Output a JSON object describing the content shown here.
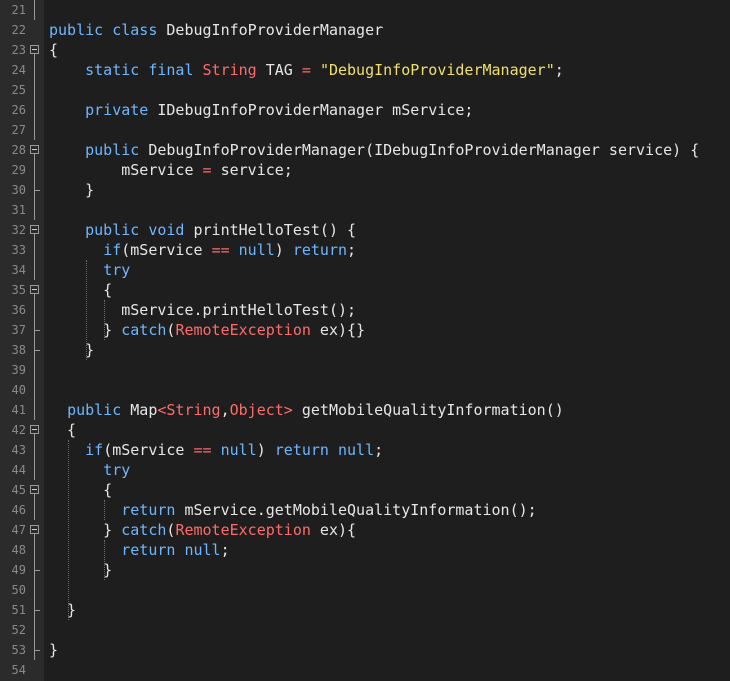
{
  "editor": {
    "lines": [
      {
        "n": "21",
        "fold": "line",
        "t": []
      },
      {
        "n": "22",
        "fold": "none",
        "t": [
          [
            "kw",
            "public"
          ],
          [
            "pl",
            " "
          ],
          [
            "kw",
            "class"
          ],
          [
            "pl",
            " DebugInfoProviderManager"
          ]
        ]
      },
      {
        "n": "23",
        "fold": "box",
        "t": [
          [
            "pl",
            "{"
          ]
        ]
      },
      {
        "n": "24",
        "fold": "line",
        "t": [
          [
            "pl",
            "    "
          ],
          [
            "kw",
            "static"
          ],
          [
            "pl",
            " "
          ],
          [
            "kw",
            "final"
          ],
          [
            "pl",
            " "
          ],
          [
            "typ",
            "String"
          ],
          [
            "pl",
            " TAG "
          ],
          [
            "op",
            "="
          ],
          [
            "pl",
            " "
          ],
          [
            "str",
            "\"DebugInfoProviderManager\""
          ],
          [
            "pl",
            ";"
          ]
        ]
      },
      {
        "n": "25",
        "fold": "line",
        "t": []
      },
      {
        "n": "26",
        "fold": "line",
        "t": [
          [
            "pl",
            "    "
          ],
          [
            "kw",
            "private"
          ],
          [
            "pl",
            " IDebugInfoProviderManager mService;"
          ]
        ]
      },
      {
        "n": "27",
        "fold": "line",
        "t": []
      },
      {
        "n": "28",
        "fold": "box",
        "t": [
          [
            "pl",
            "    "
          ],
          [
            "kw",
            "public"
          ],
          [
            "pl",
            " DebugInfoProviderManager(IDebugInfoProviderManager service) {"
          ]
        ]
      },
      {
        "n": "29",
        "fold": "line",
        "t": [
          [
            "pl",
            "        mService "
          ],
          [
            "op",
            "="
          ],
          [
            "pl",
            " service;"
          ]
        ]
      },
      {
        "n": "30",
        "fold": "end",
        "t": [
          [
            "pl",
            "    }"
          ]
        ]
      },
      {
        "n": "31",
        "fold": "line",
        "t": []
      },
      {
        "n": "32",
        "fold": "box",
        "t": [
          [
            "pl",
            "    "
          ],
          [
            "kw",
            "public"
          ],
          [
            "pl",
            " "
          ],
          [
            "kw",
            "void"
          ],
          [
            "pl",
            " printHelloTest() {"
          ]
        ]
      },
      {
        "n": "33",
        "fold": "line",
        "t": [
          [
            "pl",
            "      "
          ],
          [
            "kw",
            "if"
          ],
          [
            "pl",
            "(mService "
          ],
          [
            "op",
            "=="
          ],
          [
            "pl",
            " "
          ],
          [
            "kw",
            "null"
          ],
          [
            "pl",
            ") "
          ],
          [
            "kw",
            "return"
          ],
          [
            "pl",
            ";"
          ]
        ]
      },
      {
        "n": "34",
        "fold": "line",
        "t": [
          [
            "pl",
            "      "
          ],
          [
            "kw",
            "try"
          ]
        ]
      },
      {
        "n": "35",
        "fold": "box",
        "t": [
          [
            "pl",
            "      {"
          ]
        ]
      },
      {
        "n": "36",
        "fold": "line",
        "t": [
          [
            "pl",
            "        mService.printHelloTest();"
          ]
        ]
      },
      {
        "n": "37",
        "fold": "end",
        "t": [
          [
            "pl",
            "      } "
          ],
          [
            "kw",
            "catch"
          ],
          [
            "pl",
            "("
          ],
          [
            "typ",
            "RemoteException"
          ],
          [
            "pl",
            " ex){}"
          ]
        ]
      },
      {
        "n": "38",
        "fold": "end",
        "t": [
          [
            "pl",
            "    }"
          ]
        ]
      },
      {
        "n": "39",
        "fold": "line",
        "t": []
      },
      {
        "n": "40",
        "fold": "line",
        "t": []
      },
      {
        "n": "41",
        "fold": "line",
        "t": [
          [
            "pl",
            "  "
          ],
          [
            "kw",
            "public"
          ],
          [
            "pl",
            " Map"
          ],
          [
            "typ",
            "<String"
          ],
          [
            "pl",
            ","
          ],
          [
            "typ",
            "Object>"
          ],
          [
            "pl",
            " getMobileQualityInformation()"
          ]
        ]
      },
      {
        "n": "42",
        "fold": "box",
        "t": [
          [
            "pl",
            "  {"
          ]
        ]
      },
      {
        "n": "43",
        "fold": "line",
        "t": [
          [
            "pl",
            "    "
          ],
          [
            "kw",
            "if"
          ],
          [
            "pl",
            "(mService "
          ],
          [
            "op",
            "=="
          ],
          [
            "pl",
            " "
          ],
          [
            "kw",
            "null"
          ],
          [
            "pl",
            ") "
          ],
          [
            "kw",
            "return"
          ],
          [
            "pl",
            " "
          ],
          [
            "kw",
            "null"
          ],
          [
            "pl",
            ";"
          ]
        ]
      },
      {
        "n": "44",
        "fold": "line",
        "t": [
          [
            "pl",
            "      "
          ],
          [
            "kw",
            "try"
          ]
        ]
      },
      {
        "n": "45",
        "fold": "box",
        "t": [
          [
            "pl",
            "      {"
          ]
        ]
      },
      {
        "n": "46",
        "fold": "line",
        "t": [
          [
            "pl",
            "        "
          ],
          [
            "kw",
            "return"
          ],
          [
            "pl",
            " mService.getMobileQualityInformation();"
          ]
        ]
      },
      {
        "n": "47",
        "fold": "box",
        "t": [
          [
            "pl",
            "      } "
          ],
          [
            "kw",
            "catch"
          ],
          [
            "pl",
            "("
          ],
          [
            "typ",
            "RemoteException"
          ],
          [
            "pl",
            " ex){"
          ]
        ]
      },
      {
        "n": "48",
        "fold": "line",
        "t": [
          [
            "pl",
            "        "
          ],
          [
            "kw",
            "return"
          ],
          [
            "pl",
            " "
          ],
          [
            "kw",
            "null"
          ],
          [
            "pl",
            ";"
          ]
        ]
      },
      {
        "n": "49",
        "fold": "end",
        "t": [
          [
            "pl",
            "      }"
          ]
        ]
      },
      {
        "n": "50",
        "fold": "line",
        "t": []
      },
      {
        "n": "51",
        "fold": "end",
        "t": [
          [
            "pl",
            "  }"
          ]
        ]
      },
      {
        "n": "52",
        "fold": "line",
        "t": []
      },
      {
        "n": "53",
        "fold": "end",
        "t": [
          [
            "pl",
            "}"
          ]
        ]
      },
      {
        "n": "54",
        "fold": "none",
        "t": []
      }
    ]
  },
  "colors": {
    "background": "#1e1e1e",
    "gutter": "#2b2b2b",
    "keyword": "#6fb6ff",
    "string": "#f0e06a",
    "type": "#ff6b6b",
    "text": "#e6e6e6"
  }
}
